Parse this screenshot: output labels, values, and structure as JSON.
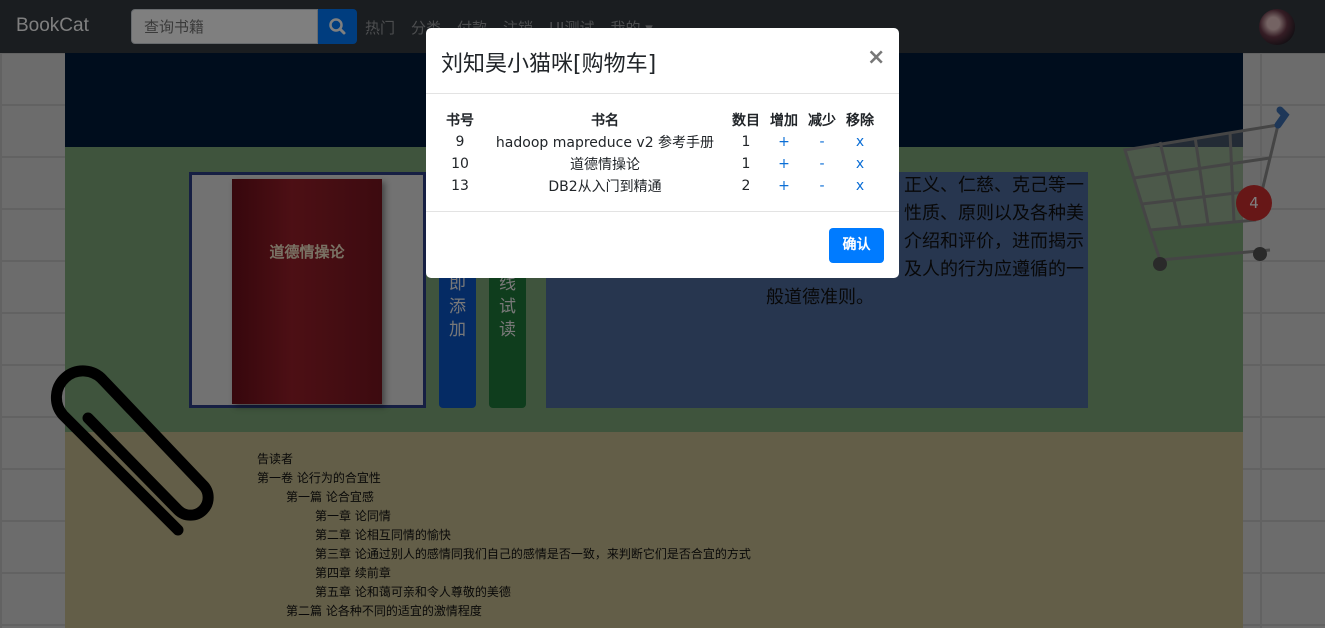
{
  "navbar": {
    "brand": "BookCat",
    "search_placeholder": "查询书籍",
    "links": [
      "热门",
      "分类",
      "付款",
      "注销",
      "UI测试",
      "我的 ▾"
    ]
  },
  "book": {
    "cover_title": "道德情操论",
    "add_button": [
      "即",
      "添",
      "加"
    ],
    "read_button": [
      "线",
      "试",
      "读"
    ],
    "description_lines": [
      "正义、仁慈、克己等一",
      "性质、原则以及各种美",
      "介绍和评价，进而揭示",
      "及人的行为应遵循的一",
      "般道德准则。"
    ]
  },
  "toc": [
    {
      "level": 0,
      "text": "告读者"
    },
    {
      "level": 0,
      "text": "第一卷  论行为的合宜性"
    },
    {
      "level": 1,
      "text": "第一篇  论合宜感"
    },
    {
      "level": 2,
      "text": "第一章  论同情"
    },
    {
      "level": 2,
      "text": "第二章  论相互同情的愉快"
    },
    {
      "level": 2,
      "text": "第三章  论通过别人的感情同我们自己的感情是否一致，来判断它们是否合宜的方式"
    },
    {
      "level": 2,
      "text": "第四章  续前章"
    },
    {
      "level": 2,
      "text": "第五章  论和蔼可亲和令人尊敬的美德"
    },
    {
      "level": 1,
      "text": "第二篇  论各种不同的适宜的激情程度"
    }
  ],
  "cart_badge": "4",
  "modal": {
    "title": "刘知昊小猫咪[购物车]",
    "close": "×",
    "headers": [
      "书号",
      "书名",
      "数目",
      "增加",
      "减少",
      "移除"
    ],
    "rows": [
      {
        "id": "9",
        "name": "hadoop mapreduce v2 参考手册",
        "qty": "1",
        "add": "+",
        "sub": "-",
        "remove": "x"
      },
      {
        "id": "10",
        "name": "道德情操论",
        "qty": "1",
        "add": "+",
        "sub": "-",
        "remove": "x"
      },
      {
        "id": "13",
        "name": "DB2从入门到精通",
        "qty": "2",
        "add": "+",
        "sub": "-",
        "remove": "x"
      }
    ],
    "confirm": "确认"
  }
}
